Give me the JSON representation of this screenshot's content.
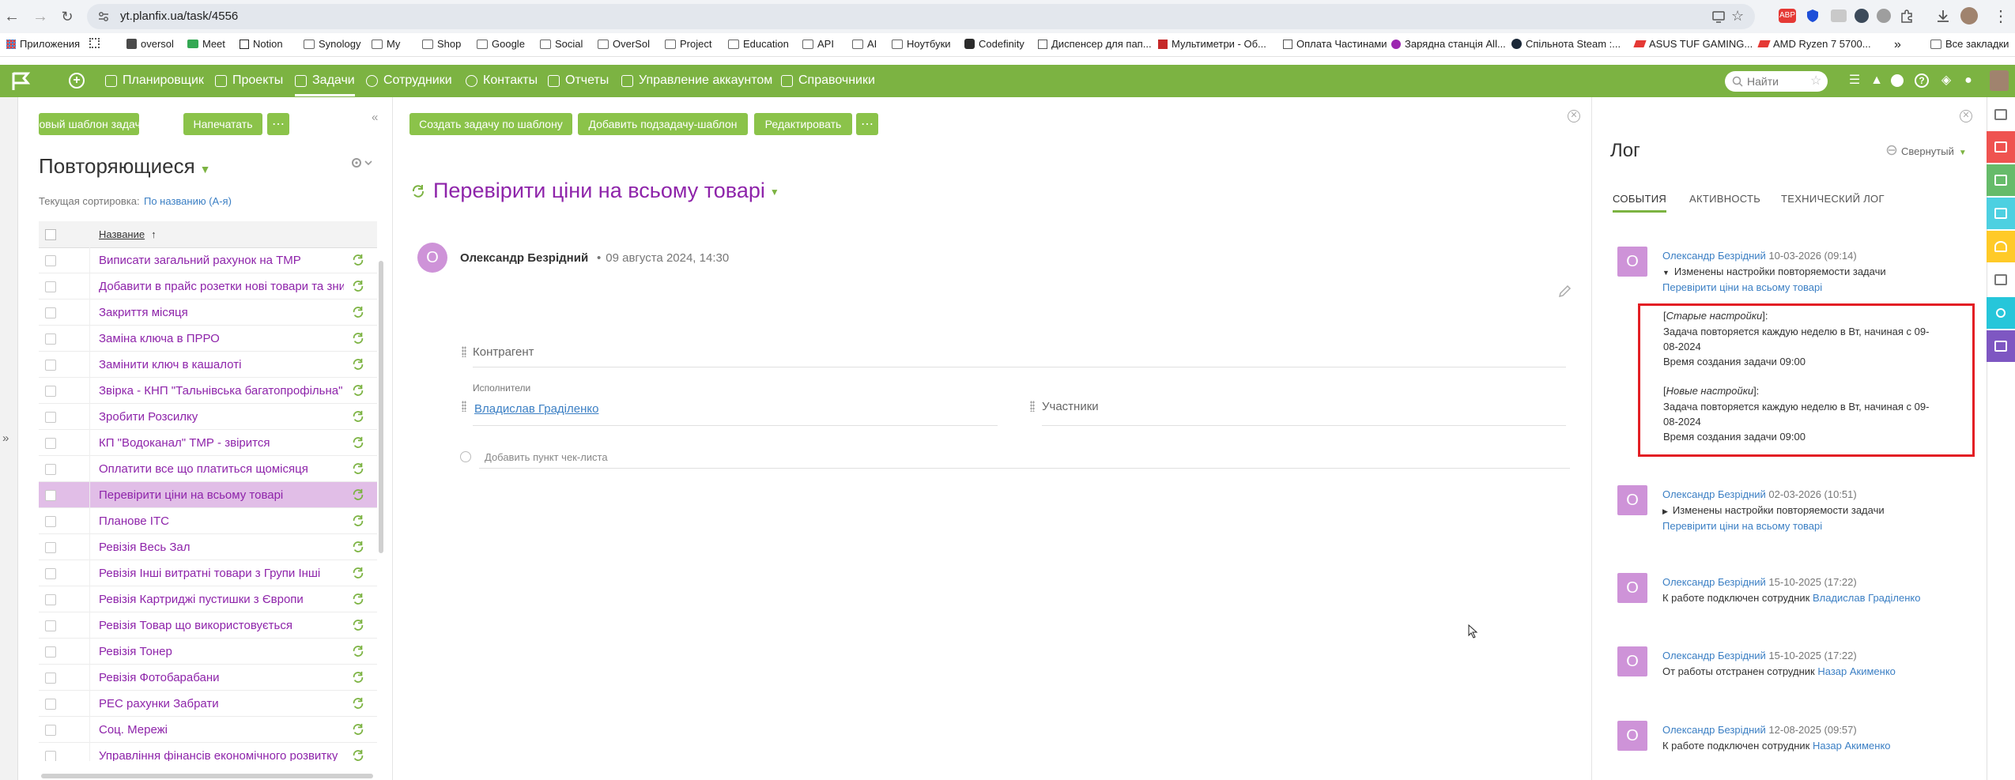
{
  "browser": {
    "url": "yt.planfix.ua/task/4556"
  },
  "bookmarks": [
    {
      "label": "Приложения"
    },
    {
      "label": ""
    },
    {
      "label": "oversol"
    },
    {
      "label": "Meet"
    },
    {
      "label": "Notion"
    },
    {
      "label": "Synology"
    },
    {
      "label": "My"
    },
    {
      "label": "Shop"
    },
    {
      "label": "Google"
    },
    {
      "label": "Social"
    },
    {
      "label": "OverSol"
    },
    {
      "label": "Project"
    },
    {
      "label": "Education"
    },
    {
      "label": "API"
    },
    {
      "label": "AI"
    },
    {
      "label": "Ноутбуки"
    },
    {
      "label": "Codefinity"
    },
    {
      "label": "Диспенсер для пап..."
    },
    {
      "label": "Мультиметри - Об..."
    },
    {
      "label": "Оплата Частинами"
    },
    {
      "label": "Зарядна станція All..."
    },
    {
      "label": "Спільнота Steam :..."
    },
    {
      "label": "ASUS TUF GAMING..."
    },
    {
      "label": "AMD Ryzen 7 5700..."
    },
    {
      "label": "Все закладки"
    }
  ],
  "nav": {
    "items": [
      {
        "label": "Планировщик"
      },
      {
        "label": "Проекты"
      },
      {
        "label": "Задачи"
      },
      {
        "label": "Сотрудники"
      },
      {
        "label": "Контакты"
      },
      {
        "label": "Отчеты"
      },
      {
        "label": "Управление аккаунтом"
      },
      {
        "label": "Справочники"
      }
    ],
    "search_placeholder": "Найти",
    "accent": "#7cb342"
  },
  "left": {
    "new_template_btn": "Новый шаблон задачи",
    "print_btn": "Напечатать",
    "title": "Повторяющиеся",
    "sort_label": "Текущая сортировка:",
    "sort_value": "По названию (А-я)",
    "column_name": "Название",
    "rows": [
      {
        "name": "Виписати загальний рахунок на ТМР"
      },
      {
        "name": "Добавити в прайс розетки нові товари та знижки"
      },
      {
        "name": "Закриття місяця"
      },
      {
        "name": "Заміна ключа в ПРРО"
      },
      {
        "name": "Замінити ключ в кашалоті"
      },
      {
        "name": "Звірка - КНП \"Тальнівська багатопрофільна\""
      },
      {
        "name": "Зробити Розсилку"
      },
      {
        "name": "КП \"Водоканал\" ТМР - звірится"
      },
      {
        "name": "Оплатити все що платиться щомісяця"
      },
      {
        "name": "Перевірити ціни на всьому товарі"
      },
      {
        "name": "Планове ІТС"
      },
      {
        "name": "Ревізія Весь Зал"
      },
      {
        "name": "Ревізія Інші витратні товари з Групи Інші"
      },
      {
        "name": "Ревізія Картриджі пустишки з Європи"
      },
      {
        "name": "Ревізія Товар що використовується"
      },
      {
        "name": "Ревізія Тонер"
      },
      {
        "name": "Ревізія Фотобарабани"
      },
      {
        "name": "РЕС рахунки Забрати"
      },
      {
        "name": "Соц. Мережі"
      },
      {
        "name": "Управління фінансів економічного розвитку"
      }
    ],
    "selected_index": 9
  },
  "task": {
    "btn_create": "Создать задачу по шаблону",
    "btn_add_sub": "Добавить подзадачу-шаблон",
    "btn_edit": "Редактировать",
    "title": "Перевірити ціни на всьому товарі",
    "author_initial": "О",
    "author": "Олександр Безрідний",
    "author_date": "09 августа 2024, 14:30",
    "field_counterparty": "Контрагент",
    "executors_label": "Исполнители",
    "executor": "Владислав Граділенко",
    "participants_label": "Участники",
    "checklist_add": "Добавить пункт чек-листа"
  },
  "log": {
    "title": "Лог",
    "collapse": "Свернутый",
    "tabs": [
      {
        "label": "События"
      },
      {
        "label": "Активность"
      },
      {
        "label": "Технический лог"
      }
    ],
    "entries": [
      {
        "initial": "О",
        "author": "Олександр Безрідний",
        "date": "10-03-2026 (09:14)",
        "text": "Изменены настройки повторяемости задачи",
        "link": "Перевірити ціни на всьому товарі"
      },
      {
        "initial": "О",
        "author": "Олександр Безрідний",
        "date": "02-03-2026 (10:51)",
        "text": "Изменены настройки повторяемости задачи",
        "link": "Перевірити ціни на всьому товарі"
      },
      {
        "initial": "О",
        "author": "Олександр Безрідний",
        "date": "15-10-2025 (17:22)",
        "text": "К работе подключен сотрудник",
        "link": "Владислав Граділенко"
      },
      {
        "initial": "О",
        "author": "Олександр Безрідний",
        "date": "15-10-2025 (17:22)",
        "text": "От работы отстранен сотрудник",
        "link": "Назар Акименко"
      },
      {
        "initial": "О",
        "author": "Олександр Безрідний",
        "date": "12-08-2025 (09:57)",
        "text": "К работе подключен сотрудник",
        "link": "Назар Акименко"
      }
    ],
    "details": {
      "old_label": "Старые настройки",
      "old_line1": "Задача повторяется каждую неделю в Вт, начиная с 09-",
      "old_line2": "08-2024",
      "old_time": "Время создания задачи 09:00",
      "new_label": "Новые настройки",
      "new_line1": "Задача повторяется каждую неделю в Вт, начиная с 09-",
      "new_line2": "08-2024",
      "new_time": "Время создания задачи 09:00"
    }
  }
}
